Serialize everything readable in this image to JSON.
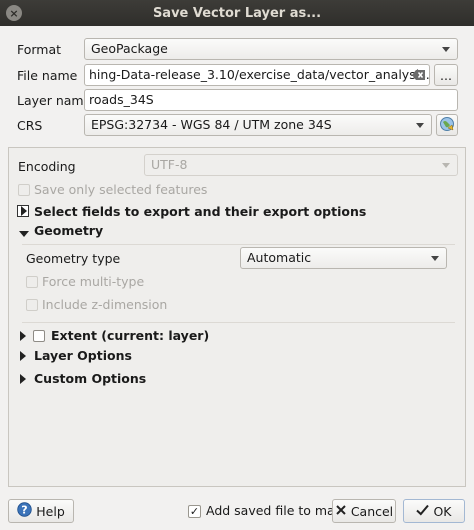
{
  "window": {
    "title": "Save Vector Layer as..."
  },
  "fields": {
    "format_label": "Format",
    "format_value": "GeoPackage",
    "filename_label": "File name",
    "filename_value": "hing-Data-release_3.10/exercise_data/vector_analysis.gpkg",
    "browse_label": "...",
    "layername_label": "Layer name",
    "layername_value": "roads_34S",
    "crs_label": "CRS",
    "crs_value": "EPSG:32734 - WGS 84 / UTM zone 34S"
  },
  "panel": {
    "encoding_label": "Encoding",
    "encoding_value": "UTF-8",
    "save_selected_label": "Save only selected features",
    "select_fields_label": "Select fields to export and their export options",
    "geometry_label": "Geometry",
    "geometry_type_label": "Geometry type",
    "geometry_type_value": "Automatic",
    "force_multi_label": "Force multi-type",
    "include_z_label": "Include z-dimension",
    "extent_label": "Extent (current: layer)",
    "layer_options_label": "Layer Options",
    "custom_options_label": "Custom Options"
  },
  "bottom": {
    "help_label": "Help",
    "add_saved_label": "Add saved file to map",
    "add_saved_checked": true,
    "cancel_label": "Cancel",
    "ok_label": "OK"
  }
}
